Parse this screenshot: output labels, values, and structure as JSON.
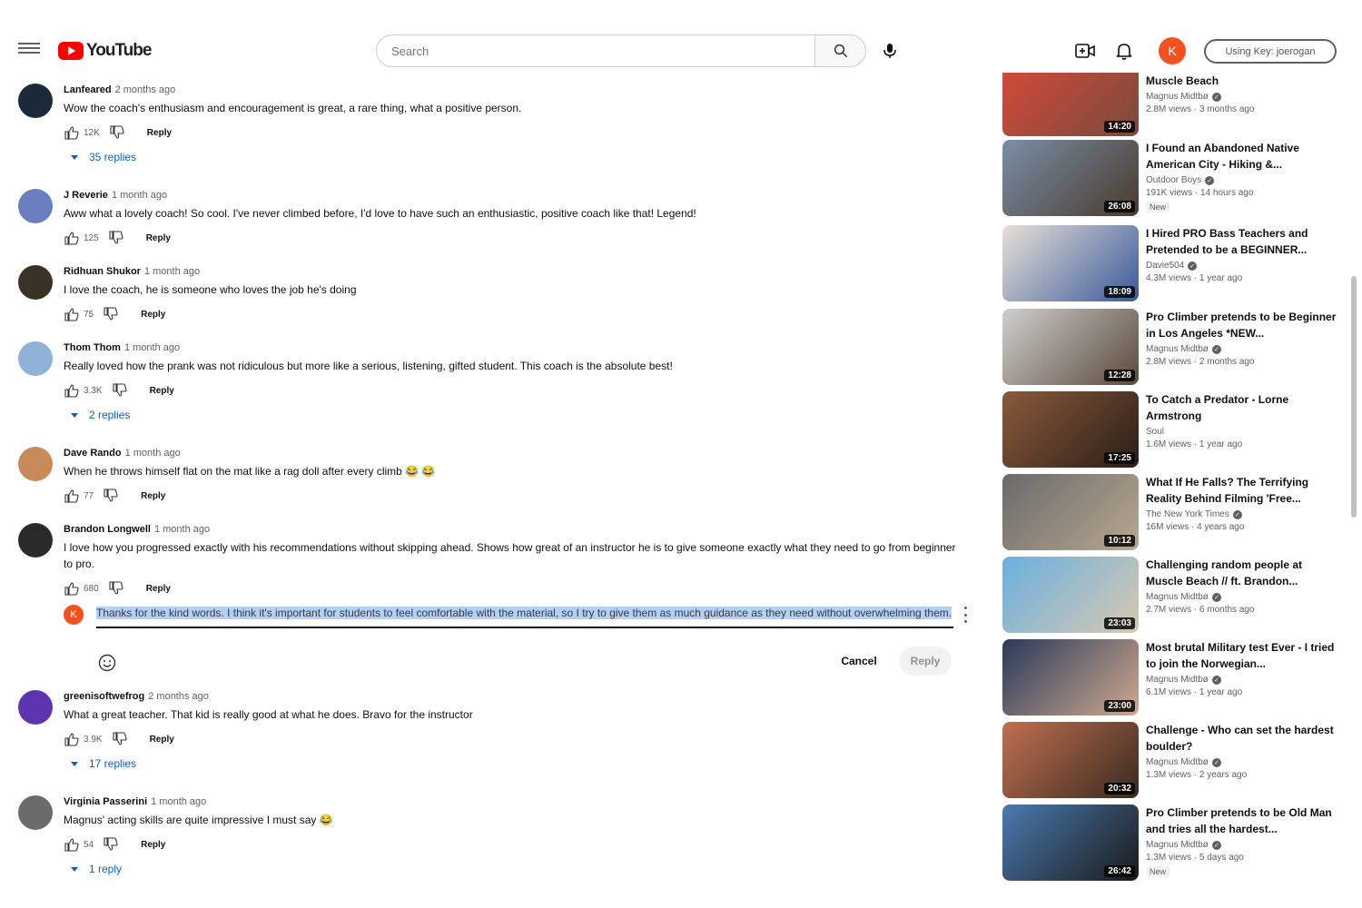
{
  "header": {
    "logo_text": "YouTube",
    "search_placeholder": "Search",
    "avatar_letter": "K",
    "api_key_label": "Using Key: joerogan"
  },
  "comments": [
    {
      "author": "Lanfeared",
      "time": "2 months ago",
      "text": "Wow the coach's enthusiasm and encouragement is great, a rare thing, what a positive person.",
      "likes": "12K",
      "reply_label": "Reply",
      "replies": "35 replies",
      "avatar_color": "#1b2a3a"
    },
    {
      "author": "J Reverie",
      "time": "1 month ago",
      "text": "Aww what a lovely coach! So cool. I've never climbed before, I'd love to have such an enthusiastic, positive coach like that! Legend!",
      "likes": "125",
      "reply_label": "Reply",
      "replies": "",
      "avatar_color": "#6a7fc0"
    },
    {
      "author": "Ridhuan Shukor",
      "time": "1 month ago",
      "text": "I love the coach, he is someone who loves the job he's doing",
      "likes": "75",
      "reply_label": "Reply",
      "replies": "",
      "avatar_color": "#3b3226"
    },
    {
      "author": "Thom Thom",
      "time": "1 month ago",
      "text": "Really loved how the prank was not ridiculous but more like a serious, listening, gifted student. This coach is the absolute best!",
      "likes": "3.3K",
      "reply_label": "Reply",
      "replies": "2 replies",
      "avatar_color": "#8fb2d6"
    },
    {
      "author": "Dave Rando",
      "time": "1 month ago",
      "text": "When he throws himself flat on the mat like a rag doll after every climb 😂 😂",
      "likes": "77",
      "reply_label": "Reply",
      "replies": "",
      "avatar_color": "#c98b5a"
    },
    {
      "author": "Brandon Longwell",
      "time": "1 month ago",
      "text": "I love how you progressed exactly with his recommendations without skipping ahead. Shows how great of an instructor he is to give someone exactly what they need to go from beginner to pro.",
      "likes": "680",
      "reply_label": "Reply",
      "replies": "",
      "avatar_color": "#2a2a2a"
    },
    {
      "author": "greenisoftwefrog",
      "time": "2 months ago",
      "text": "What a great teacher. That kid is really good at what he does. Bravo for the instructor",
      "likes": "3.9K",
      "reply_label": "Reply",
      "replies": "17 replies",
      "avatar_color": "#5e35b1"
    },
    {
      "author": "Virginia Passerini",
      "time": "1 month ago",
      "text": "Magnus' acting skills are quite impressive I must say 😂",
      "likes": "54",
      "reply_label": "Reply",
      "replies": "1 reply",
      "avatar_color": "#6b6b6b"
    }
  ],
  "reply_box": {
    "text": "Thanks for the kind words. I think it's important for students to feel comfortable with the material, so I try to give them as much guidance as they need without overwhelming them.",
    "cancel_label": "Cancel",
    "submit_label": "Reply",
    "avatar_letter": "K"
  },
  "sidebar": [
    {
      "title": "Muscle Beach",
      "channel": "Magnus Midtbø",
      "stats": "2.8M views · 3 months ago",
      "duration": "14:20",
      "badge": "",
      "color1": "#d64a3a",
      "color2": "#7a4a3a",
      "verified": true
    },
    {
      "title": "I Found an Abandoned Native American City - Hiking &...",
      "channel": "Outdoor Boys",
      "stats": "191K views · 14 hours ago",
      "duration": "26:08",
      "badge": "New",
      "color1": "#7a8fa6",
      "color2": "#4a3a2e",
      "verified": true
    },
    {
      "title": "I Hired PRO Bass Teachers and Pretended to be a BEGINNER...",
      "channel": "Davie504",
      "stats": "4.3M views · 1 year ago",
      "duration": "18:09",
      "badge": "",
      "color1": "#e8e0d8",
      "color2": "#3a5a9a",
      "verified": true
    },
    {
      "title": "Pro Climber pretends to be Beginner in Los Angeles *NEW...",
      "channel": "Magnus Midtbø",
      "stats": "2.8M views · 2 months ago",
      "duration": "12:28",
      "badge": "",
      "color1": "#cfcfcf",
      "color2": "#5a4a3a",
      "verified": true
    },
    {
      "title": "To Catch a Predator - Lorne Armstrong",
      "channel": "Soul",
      "stats": "1.6M views · 1 year ago",
      "duration": "17:25",
      "badge": "",
      "color1": "#8a5a3a",
      "color2": "#2a1e18",
      "verified": false
    },
    {
      "title": "What If He Falls? The Terrifying Reality Behind Filming 'Free...",
      "channel": "The New York Times",
      "stats": "16M views · 4 years ago",
      "duration": "10:12",
      "badge": "",
      "color1": "#6a6a6a",
      "color2": "#b8a890",
      "verified": true
    },
    {
      "title": "Challenging random people at Muscle Beach // ft. Brandon...",
      "channel": "Magnus Midtbø",
      "stats": "2.7M views · 6 months ago",
      "duration": "23:03",
      "badge": "",
      "color1": "#6ab0e0",
      "color2": "#d8c8b0",
      "verified": true
    },
    {
      "title": "Most brutal Military test Ever - I tried to join the Norwegian...",
      "channel": "Magnus Midtbø",
      "stats": "6.1M views · 1 year ago",
      "duration": "23:00",
      "badge": "",
      "color1": "#2a3a5a",
      "color2": "#d0a890",
      "verified": true
    },
    {
      "title": "Challenge - Who can set the hardest boulder?",
      "channel": "Magnus Midtbø",
      "stats": "1.3M views · 2 years ago",
      "duration": "20:32",
      "badge": "",
      "color1": "#c07050",
      "color2": "#3a2a20",
      "verified": true
    },
    {
      "title": "Pro Climber pretends to be Old Man and tries all the hardest...",
      "channel": "Magnus Midtbø",
      "stats": "1.3M views · 5 days ago",
      "duration": "26:42",
      "badge": "New",
      "color1": "#4a7ab0",
      "color2": "#1a1a1a",
      "verified": true
    }
  ]
}
